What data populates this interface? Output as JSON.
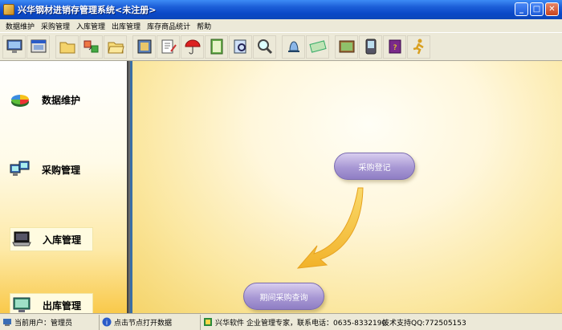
{
  "window": {
    "title": "兴华钢材进销存管理系统<未注册>",
    "controls": [
      "minimize",
      "maximize",
      "close"
    ]
  },
  "menu": {
    "items": [
      "数据维护",
      "采购管理",
      "入库管理",
      "出库管理",
      "库存商品统计",
      "帮助"
    ]
  },
  "toolbar": {
    "icons": [
      "monitor-icon",
      "window-icon",
      "folder-icon",
      "transfer-icon",
      "folder-open-icon",
      "film-icon",
      "write-icon",
      "umbrella-icon",
      "notebook-icon",
      "search-doc-icon",
      "magnifier-icon",
      "bell-icon",
      "money-icon",
      "picture-icon",
      "pda-icon",
      "book-icon",
      "runner-icon"
    ]
  },
  "sidebar": {
    "items": [
      {
        "label": "数据维护",
        "icon": "pie-chart-icon"
      },
      {
        "label": "采购管理",
        "icon": "computers-icon"
      },
      {
        "label": "入库管理",
        "icon": "laptop-icon"
      },
      {
        "label": "出库管理",
        "icon": "display-icon"
      }
    ]
  },
  "main": {
    "nodes": [
      {
        "label": "采购登记"
      },
      {
        "label": "期间采购查询"
      }
    ]
  },
  "statusbar": {
    "user": "当前用户：管理员",
    "hint": "点击节点打开数据",
    "brand": "兴华软件",
    "contact": "企业管理专家，联系电话：0635-8332190",
    "support": "技术支持QQ:772505153"
  }
}
